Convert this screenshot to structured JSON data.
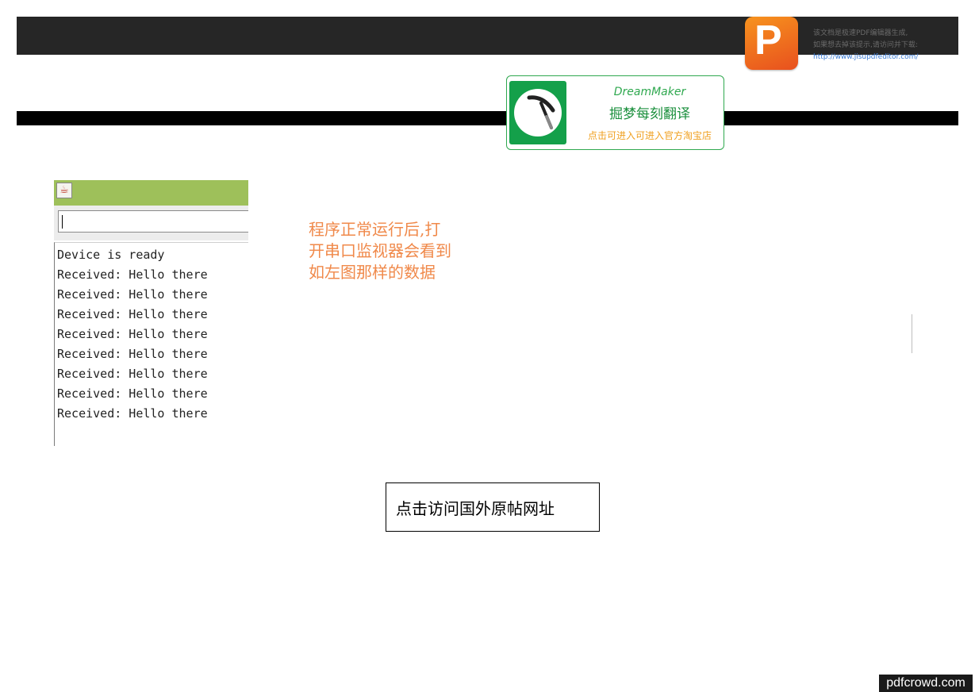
{
  "header": {
    "notice_line1": "该文档是极速PDF编辑器生成,",
    "notice_line2": "如果想去掉该提示,请访问并下载:",
    "notice_link": "http://www.jisupdfeditor.com/",
    "logo_letter": "P"
  },
  "badge": {
    "brand": "DreamMaker",
    "title": "掘梦每刻翻译",
    "subtitle": "点击可进入可进入官方淘宝店"
  },
  "serial_monitor": {
    "icon": "java-icon",
    "lines": [
      "Device is ready",
      "Received: Hello there",
      "Received: Hello there",
      "Received: Hello there",
      "Received: Hello there",
      "Received: Hello there",
      "Received: Hello there",
      "Received: Hello there",
      "Received: Hello there"
    ]
  },
  "instruction": {
    "line1": "程序正常运行后,打",
    "line2": "开串口监视器会看到",
    "line3": "如左图那样的数据"
  },
  "link_box": {
    "label": "点击访问国外原帖网址"
  },
  "footer": {
    "pdfcrowd": "pdfcrowd.com"
  },
  "colors": {
    "accent_green": "#2fa84f",
    "instruction_orange": "#f0894a",
    "titlebar_green": "#9ec05a"
  }
}
